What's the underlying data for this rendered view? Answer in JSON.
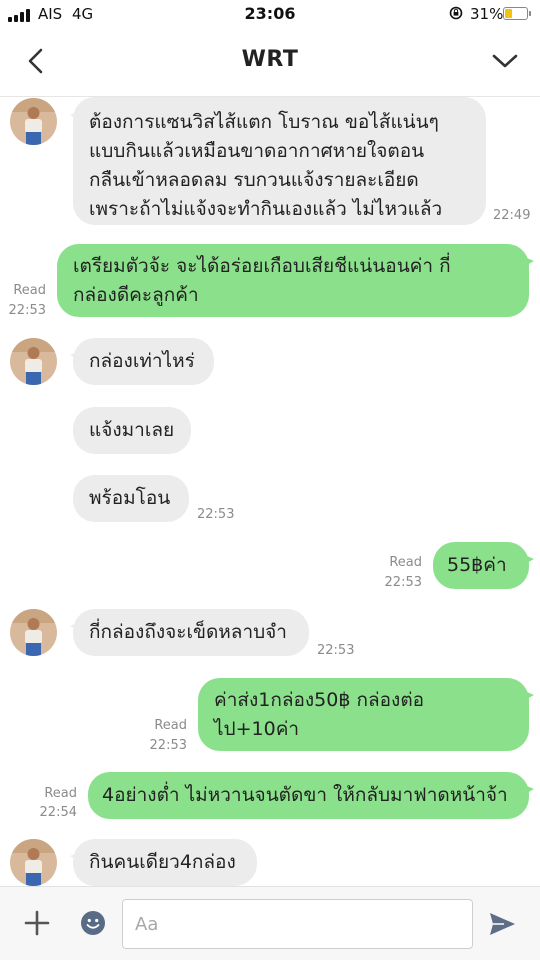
{
  "status_bar": {
    "carrier": "AIS",
    "network": "4G",
    "time": "23:06",
    "battery_percent": "31%",
    "battery_color": "#f3c30f"
  },
  "header": {
    "title": "WRT",
    "back_icon": "chevron-left-icon",
    "menu_icon": "chevron-down-icon"
  },
  "messages": [
    {
      "side": "in",
      "lines": [
        "ต้องการแซนวิสไส้แตก โบราณ ขอไส้แน่นๆ",
        "แบบกินแล้วเหมือนขาดอากาศหายใจตอน",
        "กลืนเข้าหลอดลม รบกวนแจ้งรายละเอียด",
        "เพราะถ้าไม่แจ้งจะทำกินเองแล้ว ไม่ไหวแล้ว"
      ],
      "time": "22:49"
    },
    {
      "side": "out",
      "lines": [
        "เตรียมตัวจ้ะ จะได้อร่อยเกือบเสียชีแน่นอนค่า กี่",
        "กล่องดีคะลูกค้า"
      ],
      "read": "Read",
      "time": "22:53"
    },
    {
      "side": "in",
      "lines": [
        "กล่องเท่าไหร่"
      ]
    },
    {
      "side": "in",
      "lines": [
        "แจ้งมาเลย"
      ]
    },
    {
      "side": "in",
      "lines": [
        "พร้อมโอน"
      ],
      "time": "22:53"
    },
    {
      "side": "out",
      "lines": [
        "55฿ค่า"
      ],
      "read": "Read",
      "time": "22:53"
    },
    {
      "side": "in",
      "lines": [
        "กี่กล่องถึงจะเข็ดหลาบจำ"
      ],
      "time": "22:53"
    },
    {
      "side": "out",
      "lines": [
        "ค่าส่ง1กล่อง50฿ กล่องต่อ",
        "ไป+10ค่า"
      ],
      "read": "Read",
      "time": "22:53"
    },
    {
      "side": "out",
      "lines": [
        "4อย่างต่ำ ไม่หวานจนตัดขา ให้กลับมาฟาดหน้าจ้า"
      ],
      "read": "Read",
      "time": "22:54"
    },
    {
      "side": "in",
      "lines": [
        "กินคนเดียว4กล่อง"
      ]
    }
  ],
  "input_bar": {
    "placeholder": "Aa",
    "icons": [
      "plus-icon",
      "emoji-icon",
      "send-icon"
    ]
  },
  "colors": {
    "outgoing_bubble": "#8be08b",
    "incoming_bubble": "#ececec",
    "meta_text": "#8b8b8b"
  }
}
